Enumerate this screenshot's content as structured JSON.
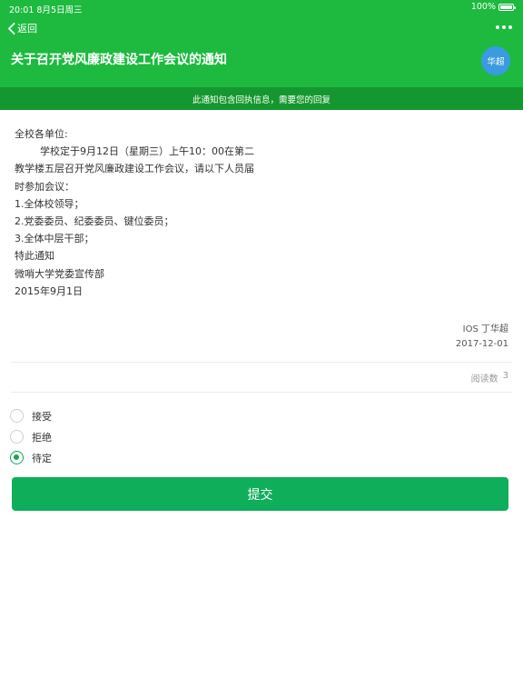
{
  "status_bar": {
    "time_date": "20:01   8月5日周三",
    "battery": "100%"
  },
  "nav": {
    "back_label": "返回",
    "more_icon": "ellipsis-icon"
  },
  "header": {
    "title": "关于召开党风廉政建设工作会议的通知",
    "avatar_text": "华超"
  },
  "banner": {
    "text": "此通知包含回执信息，需要您的回复"
  },
  "content": {
    "lines": [
      "全校各单位:",
      "        学校定于9月12日（星期三）上午10：00在第二",
      "教学楼五层召开党风廉政建设工作会议，请以下人员届",
      "时参加会议：",
      "1.全体校领导；",
      "2.党委委员、纪委委员、键位委员；",
      "3.全体中层干部；",
      "特此通知",
      "微哨大学党委宣传部",
      "2015年9月1日"
    ]
  },
  "meta": {
    "author": "IOS 丁华超",
    "date": "2017-12-01",
    "read_label": "阅读数",
    "read_count": "3"
  },
  "options": [
    {
      "label": "接受",
      "checked": false
    },
    {
      "label": "拒绝",
      "checked": false
    },
    {
      "label": "待定",
      "checked": true
    }
  ],
  "submit_label": "提交",
  "colors": {
    "header": "#1dba3f",
    "banner": "#15972f",
    "accent": "#0fae5a",
    "avatar": "#3a9be0"
  }
}
